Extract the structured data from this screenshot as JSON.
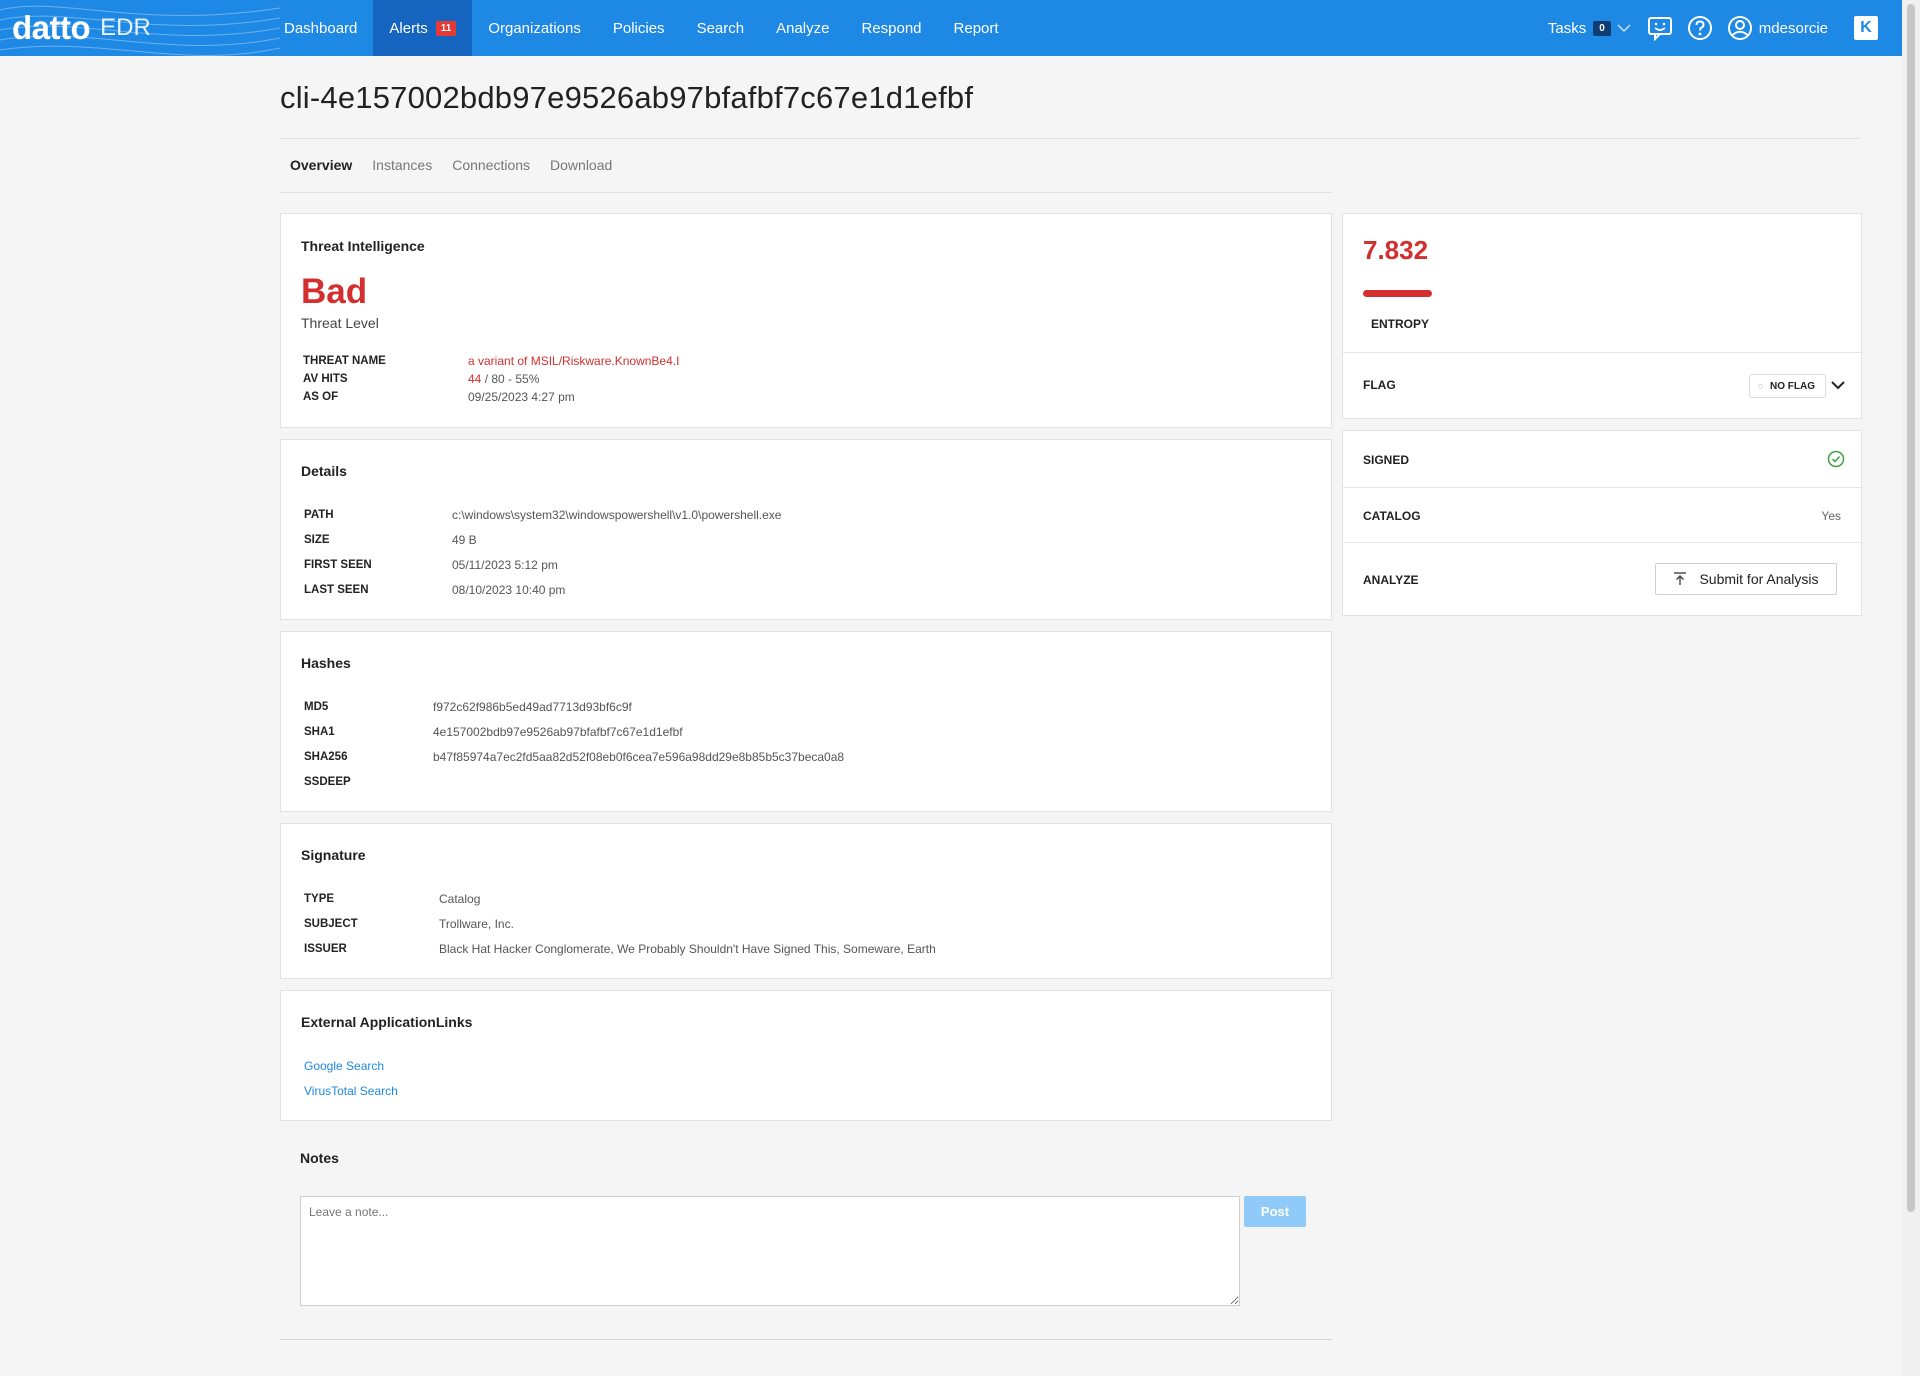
{
  "brand": {
    "name": "datto",
    "product": "EDR"
  },
  "nav": {
    "items": [
      {
        "label": "Dashboard"
      },
      {
        "label": "Alerts",
        "badge": "11"
      },
      {
        "label": "Organizations"
      },
      {
        "label": "Policies"
      },
      {
        "label": "Search"
      },
      {
        "label": "Analyze"
      },
      {
        "label": "Respond"
      },
      {
        "label": "Report"
      }
    ],
    "tasks_label": "Tasks",
    "tasks_count": "0",
    "username": "mdesorcie"
  },
  "page": {
    "title": "cli-4e157002bdb97e9526ab97bfafbf7c67e1d1efbf",
    "tabs": [
      "Overview",
      "Instances",
      "Connections",
      "Download"
    ]
  },
  "threat": {
    "title": "Threat Intelligence",
    "level": "Bad",
    "level_label": "Threat Level",
    "rows": [
      {
        "key": "THREAT NAME",
        "value": "a variant of MSIL/Riskware.KnownBe4.I"
      },
      {
        "key": "AV HITS",
        "hits": "44",
        "rest": " / 80 - 55%"
      },
      {
        "key": "AS OF",
        "value": "09/25/2023 4:27 pm"
      }
    ]
  },
  "details": {
    "title": "Details",
    "rows": [
      {
        "key": "PATH",
        "value": "c:\\windows\\system32\\windowspowershell\\v1.0\\powershell.exe"
      },
      {
        "key": "SIZE",
        "value": "49 B"
      },
      {
        "key": "FIRST SEEN",
        "value": "05/11/2023 5:12 pm"
      },
      {
        "key": "LAST SEEN",
        "value": "08/10/2023 10:40 pm"
      }
    ]
  },
  "hashes": {
    "title": "Hashes",
    "rows": [
      {
        "key": "MD5",
        "value": "f972c62f986b5ed49ad7713d93bf6c9f"
      },
      {
        "key": "SHA1",
        "value": "4e157002bdb97e9526ab97bfafbf7c67e1d1efbf"
      },
      {
        "key": "SHA256",
        "value": "b47f85974a7ec2fd5aa82d52f08eb0f6cea7e596a98dd29e8b85b5c37beca0a8"
      },
      {
        "key": "SSDEEP",
        "value": ""
      }
    ]
  },
  "signature": {
    "title": "Signature",
    "rows": [
      {
        "key": "TYPE",
        "value": "Catalog"
      },
      {
        "key": "SUBJECT",
        "value": "Trollware, Inc."
      },
      {
        "key": "ISSUER",
        "value": "Black Hat Hacker Conglomerate, We Probably Shouldn't Have Signed This, Someware, Earth"
      }
    ]
  },
  "external": {
    "title": "External ApplicationLinks",
    "links": [
      "Google Search",
      "VirusTotal Search"
    ]
  },
  "entropy": {
    "value": "7.832",
    "label": "ENTROPY",
    "color": "#d32f2f"
  },
  "flag": {
    "label": "FLAG",
    "value": "NO FLAG"
  },
  "file_meta": {
    "signed_label": "SIGNED",
    "catalog_label": "CATALOG",
    "catalog_value": "Yes",
    "analyze_label": "ANALYZE",
    "analyze_button": "Submit for Analysis"
  },
  "notes": {
    "title": "Notes",
    "placeholder": "Leave a note...",
    "post_label": "Post"
  },
  "colors": {
    "primary": "#1e88e5",
    "primary_dark": "#1565c0",
    "danger": "#d32f2f",
    "success": "#43a047"
  }
}
